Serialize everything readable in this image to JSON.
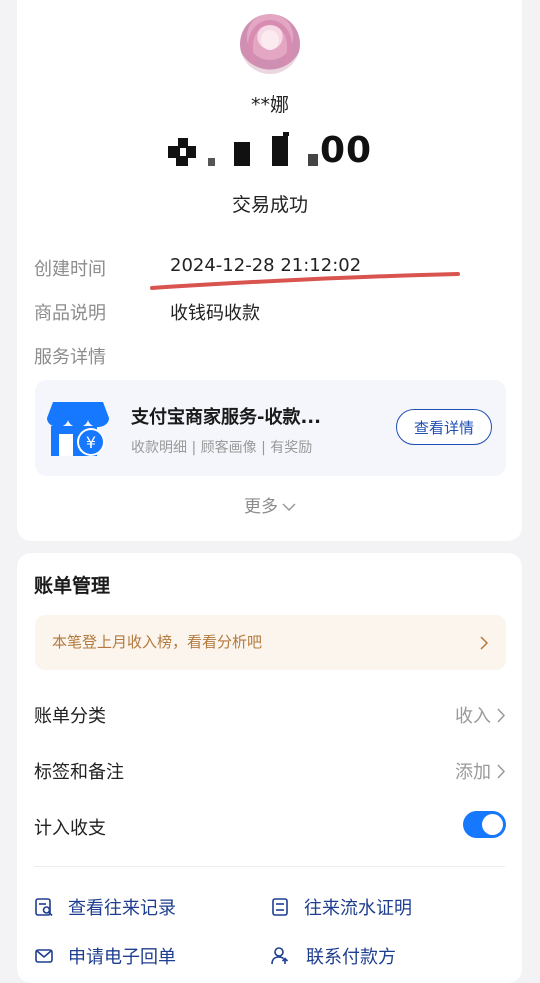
{
  "header": {
    "payer_name": "**娜",
    "amount_tail": "00",
    "status": "交易成功"
  },
  "details": {
    "created_label": "创建时间",
    "created_value": "2024-12-28 21:12:02",
    "product_label": "商品说明",
    "product_value": "收钱码收款",
    "service_label": "服务详情"
  },
  "service_card": {
    "title": "支付宝商家服务-收款...",
    "tags": "收款明细 | 顾客画像 | 有奖励",
    "button": "查看详情",
    "icon": "shop-yuan-icon"
  },
  "more": "更多",
  "bill": {
    "title": "账单管理",
    "promo": "本笔登上月收入榜，看看分析吧",
    "category_label": "账单分类",
    "category_value": "收入",
    "tag_label": "标签和备注",
    "tag_value": "添加",
    "include_label": "计入收支",
    "include_on": true
  },
  "actions": {
    "history": "查看往来记录",
    "statement": "往来流水证明",
    "receipt": "申请电子回单",
    "contact": "联系付款方"
  },
  "colors": {
    "accent": "#1677ff",
    "link": "#1f3e8f",
    "promo_text": "#b37a3d",
    "annotation": "#d9534f"
  }
}
